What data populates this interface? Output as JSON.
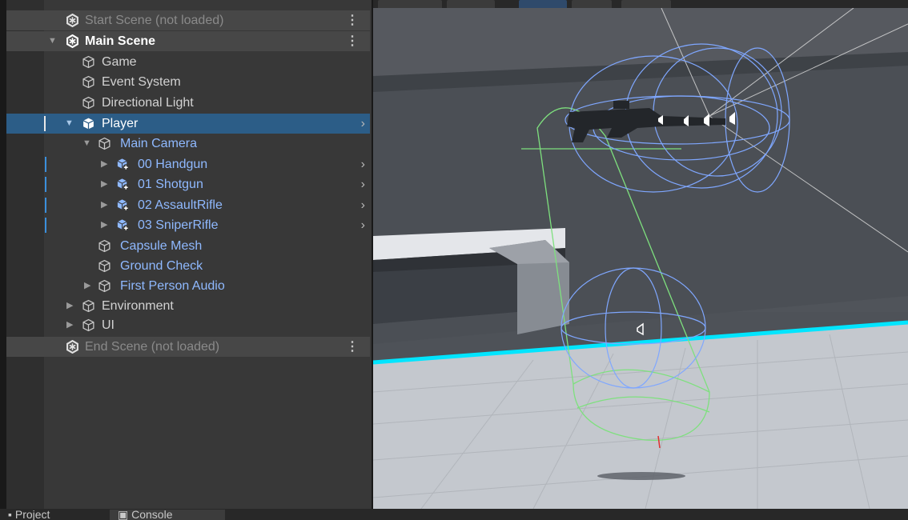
{
  "hierarchy": {
    "scenes": {
      "start": "Start Scene (not loaded)",
      "main": "Main Scene",
      "end": "End Scene (not loaded)"
    },
    "items": {
      "game": "Game",
      "event_system": "Event System",
      "directional_light": "Directional Light",
      "player": "Player",
      "main_camera": "Main Camera",
      "handgun": "00 Handgun",
      "shotgun": "01 Shotgun",
      "assault_rifle": "02 AssaultRifle",
      "sniper_rifle": "03 SniperRifle",
      "capsule_mesh": "Capsule Mesh",
      "ground_check": "Ground Check",
      "first_person_audio": "First Person Audio",
      "environment": "Environment",
      "ui": "UI"
    }
  },
  "bottom_tabs": {
    "project": "Project",
    "console": "Console"
  },
  "colors": {
    "panel_bg": "#383838",
    "selection": "#2c5d87",
    "prefab_text": "#8fb9ff",
    "floor_edge": "#00e5ff",
    "collider_green": "#7ee07e",
    "gizmo_blue": "#7fa7ff"
  }
}
